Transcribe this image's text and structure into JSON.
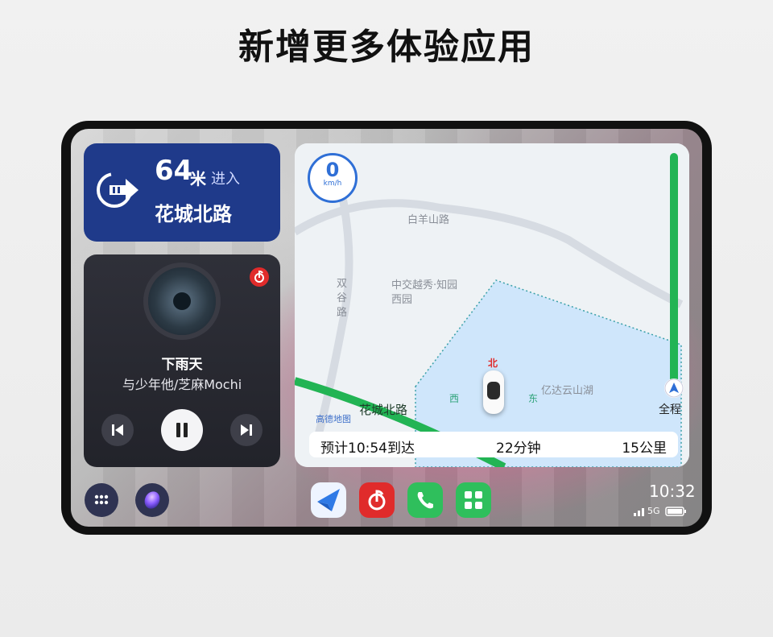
{
  "headline": "新增更多体验应用",
  "navigation_card": {
    "distance": "64",
    "unit": "米",
    "action": "进入",
    "road": "花城北路"
  },
  "music_card": {
    "song_title": "下雨天",
    "artist": "与少年他/芝麻Mochi"
  },
  "map_card": {
    "speed_value": "0",
    "speed_unit": "km/h",
    "labels": {
      "road_top": "白羊山路",
      "road_left": "双谷路",
      "poi": "中交越秀·知园西园",
      "lake": "亿达云山湖",
      "road_bottom": "花城北路",
      "brand": "高德地图"
    },
    "compass": {
      "north": "北",
      "west": "西",
      "east": "东"
    },
    "full_route_label": "全程",
    "route_progress": 0.0,
    "eta": {
      "arrival": "预计10:54到达",
      "duration": "22分钟",
      "distance": "15公里"
    }
  },
  "status_bar": {
    "time": "10:32",
    "network": "5G"
  },
  "colors": {
    "nav_card": "#1f3a8a",
    "music_card": "#2a2b33",
    "route_green": "#22b454",
    "lake_blue": "#cfe6fb",
    "speed_blue": "#2f6fd6"
  },
  "dock": {
    "left_buttons": [
      "app-grid-icon",
      "voice-assistant-icon"
    ],
    "apps": [
      "navigation-app-icon",
      "music-app-icon",
      "phone-app-icon",
      "launcher-app-icon"
    ]
  }
}
